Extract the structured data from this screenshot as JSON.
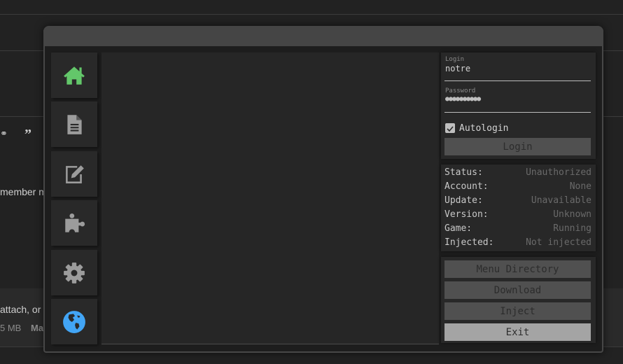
{
  "background": {
    "text_member": "member m",
    "text_attach": "attach, or",
    "text_size": "5 MB",
    "text_ma": "Ma"
  },
  "sidebar": {
    "items": [
      {
        "name": "home",
        "icon": "home-icon",
        "color": "#63c76a",
        "active": true
      },
      {
        "name": "document",
        "icon": "document-icon",
        "color": "#9c9c9c"
      },
      {
        "name": "edit",
        "icon": "edit-icon",
        "color": "#9c9c9c"
      },
      {
        "name": "plugins",
        "icon": "puzzle-icon",
        "color": "#9c9c9c"
      },
      {
        "name": "settings",
        "icon": "gear-icon",
        "color": "#9c9c9c"
      },
      {
        "name": "web",
        "icon": "globe-icon",
        "color": "#42a5f5"
      }
    ]
  },
  "login": {
    "login_label": "Login",
    "login_value": "notre",
    "password_label": "Password",
    "password_value": "●●●●●●●●●●",
    "autologin_label": "Autologin",
    "autologin_checked": true,
    "login_button": "Login"
  },
  "status": {
    "rows": [
      {
        "key": "Status:",
        "value": "Unauthorized"
      },
      {
        "key": "Account:",
        "value": "None"
      },
      {
        "key": "Update:",
        "value": "Unavailable"
      },
      {
        "key": "Version:",
        "value": "Unknown"
      },
      {
        "key": "Game:",
        "value": "Running"
      },
      {
        "key": "Injected:",
        "value": "Not injected"
      }
    ]
  },
  "actions": {
    "menu_directory": "Menu Directory",
    "download": "Download",
    "inject": "Inject",
    "exit": "Exit"
  }
}
